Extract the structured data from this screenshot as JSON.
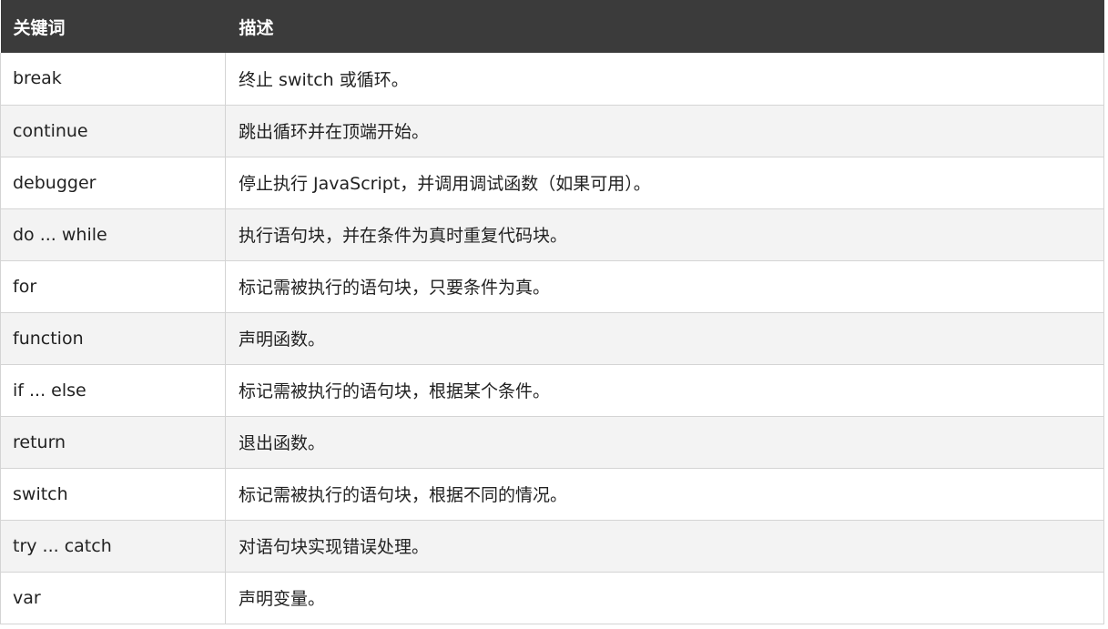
{
  "table": {
    "headers": {
      "keyword": "关键词",
      "description": "描述"
    },
    "rows": [
      {
        "keyword": "break",
        "description": "终止 switch 或循环。"
      },
      {
        "keyword": "continue",
        "description": "跳出循环并在顶端开始。"
      },
      {
        "keyword": "debugger",
        "description": "停止执行 JavaScript，并调用调试函数（如果可用）。"
      },
      {
        "keyword": "do ... while",
        "description": "执行语句块，并在条件为真时重复代码块。"
      },
      {
        "keyword": "for",
        "description": "标记需被执行的语句块，只要条件为真。"
      },
      {
        "keyword": "function",
        "description": "声明函数。"
      },
      {
        "keyword": "if ... else",
        "description": "标记需被执行的语句块，根据某个条件。"
      },
      {
        "keyword": "return",
        "description": "退出函数。"
      },
      {
        "keyword": "switch",
        "description": "标记需被执行的语句块，根据不同的情况。"
      },
      {
        "keyword": "try ... catch",
        "description": "对语句块实现错误处理。"
      },
      {
        "keyword": "var",
        "description": "声明变量。"
      }
    ]
  },
  "colors": {
    "header_background": "#3b3b3b",
    "header_text": "#ffffff",
    "row_alt_background": "#f3f3f3",
    "border": "#d4d4d4"
  }
}
